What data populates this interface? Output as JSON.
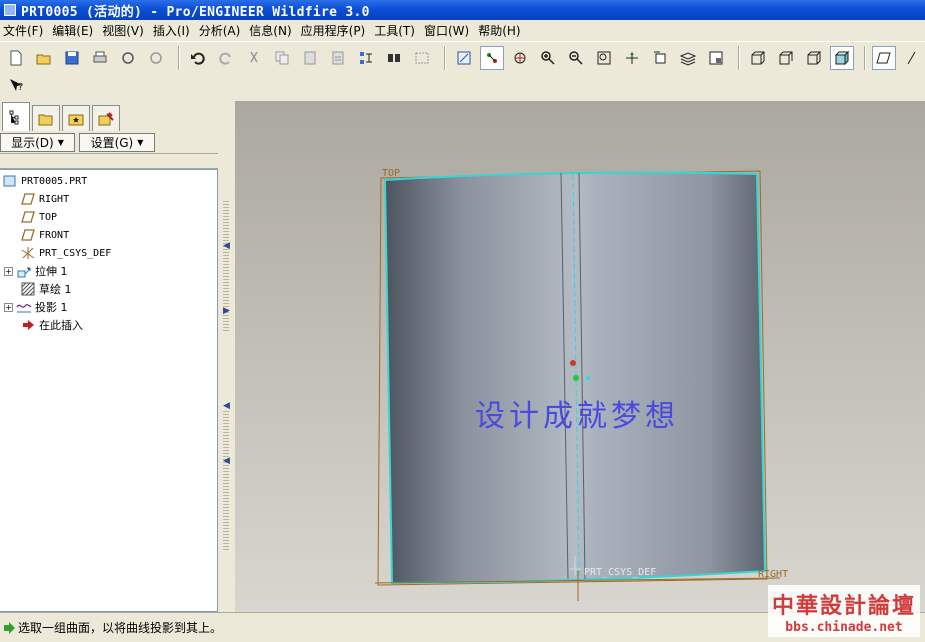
{
  "window": {
    "title": "PRT0005 (活动的) - Pro/ENGINEER Wildfire 3.0"
  },
  "menu": [
    {
      "label": "文件(F)"
    },
    {
      "label": "编辑(E)"
    },
    {
      "label": "视图(V)"
    },
    {
      "label": "插入(I)"
    },
    {
      "label": "分析(A)"
    },
    {
      "label": "信息(N)"
    },
    {
      "label": "应用程序(P)"
    },
    {
      "label": "工具(T)"
    },
    {
      "label": "窗口(W)"
    },
    {
      "label": "帮助(H)"
    }
  ],
  "toolbar": {
    "icons": [
      "new-icon",
      "open-icon",
      "save-icon",
      "print-icon",
      "send-mail-icon",
      "send-mail-alt-icon",
      "undo-icon",
      "redo-icon",
      "cut-icon",
      "copy-icon",
      "paste-icon",
      "paste-special-icon",
      "regenerate-icon",
      "find-icon",
      "select-box-icon",
      "repaint-icon",
      "spin-center-icon",
      "orient-icon",
      "zoom-in-icon",
      "zoom-out-icon",
      "refit-icon",
      "reorient-icon",
      "saved-views-icon",
      "layers-icon",
      "view-manager-icon",
      "wireframe-icon",
      "hidden-line-icon",
      "no-hidden-icon",
      "shading-icon",
      "datum-plane-icon",
      "datum-axis-icon",
      "context-help-icon"
    ]
  },
  "left_panel": {
    "show_label": "显示(D)",
    "settings_label": "设置(G)",
    "tabs": [
      "model-tree-tab",
      "folder-browser-tab",
      "favorites-tab",
      "connections-tab"
    ]
  },
  "model_tree": {
    "root": "PRT0005.PRT",
    "items": [
      {
        "label": "RIGHT",
        "icon": "datum-plane-icon"
      },
      {
        "label": "TOP",
        "icon": "datum-plane-icon"
      },
      {
        "label": "FRONT",
        "icon": "datum-plane-icon"
      },
      {
        "label": "PRT_CSYS_DEF",
        "icon": "csys-icon"
      },
      {
        "label": "拉伸 1",
        "icon": "extrude-icon"
      },
      {
        "label": "草绘 1",
        "icon": "sketch-icon"
      },
      {
        "label": "投影 1",
        "icon": "projection-icon"
      },
      {
        "label": "在此插入",
        "icon": "insert-here-icon"
      }
    ]
  },
  "viewport": {
    "datum_labels": {
      "top": "TOP",
      "right": "RIGHT",
      "csys": "PRT_CSYS_DEF"
    },
    "overlay_text": "设计成就梦想"
  },
  "status": {
    "message": "选取一组曲面，以将曲线投影到其上。"
  },
  "watermark": {
    "name": "中華設計論壇",
    "url": "bbs.chinade.net"
  },
  "colors": {
    "title_bar": "#0a4fd6",
    "highlight_edge": "#35d6d6",
    "overlay_text": "#4a4ae0",
    "datum_plane": "#9c6a2a",
    "watermark": "#d23b3b"
  }
}
